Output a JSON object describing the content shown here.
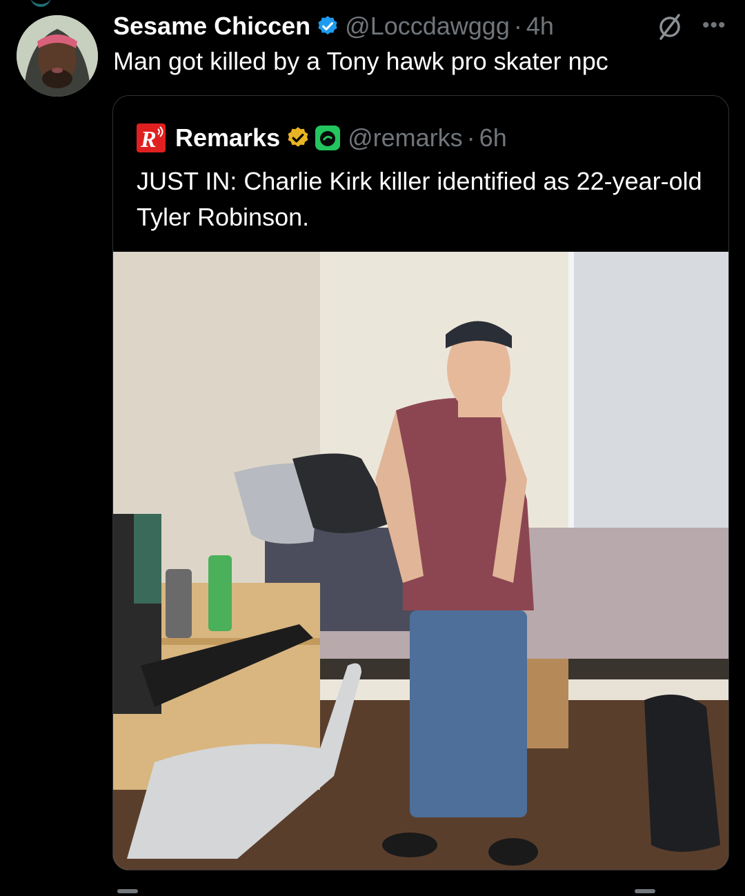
{
  "tweet": {
    "author_name": "Sesame Chiccen",
    "handle": "@Loccdawggg",
    "separator": "·",
    "time": "4h",
    "text": "Man got killed by a Tony hawk pro skater npc",
    "verified_color": "#1d9bf0"
  },
  "quote": {
    "author_name": "Remarks",
    "handle": "@remarks",
    "separator": "·",
    "time": "6h",
    "text": "JUST IN: Charlie Kirk killer identified as 22-year-old Tyler Robinson.",
    "logo_letter": "R",
    "logo_color": "#e02020",
    "badge_color": "#e8b324",
    "affiliate_color": "#22c55e"
  },
  "icons": {
    "verified": "verified-badge-icon",
    "grok": "grok-icon",
    "more": "more-icon",
    "gold_badge": "gold-verified-badge-icon"
  }
}
